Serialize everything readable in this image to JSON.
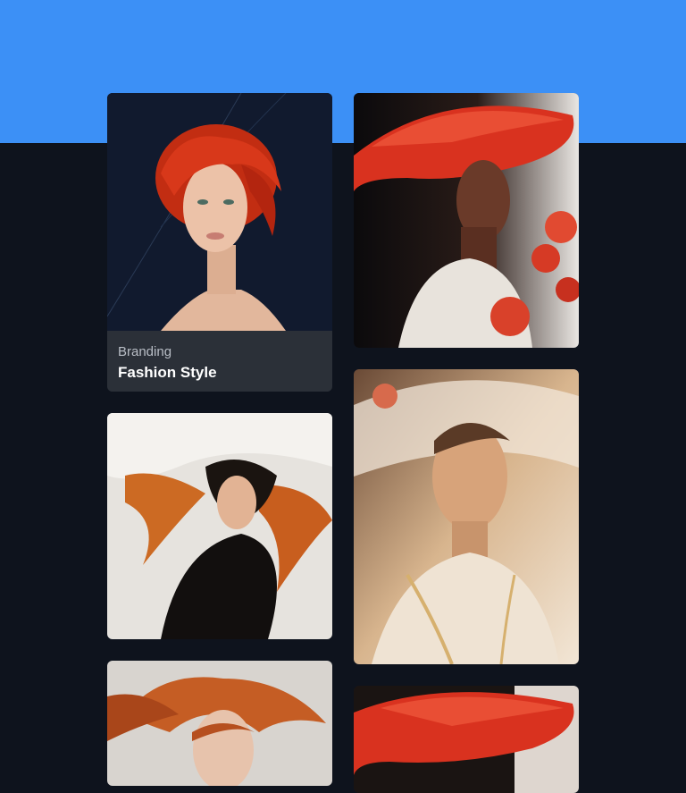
{
  "cards": [
    {
      "image": "portrait-red-curly-hair-navy-background",
      "category": "Branding",
      "title": "Fashion Style"
    },
    {
      "image": "portrait-woman-red-wide-brim-hat-roses"
    },
    {
      "image": "portrait-woman-flowing-hair-white-veil"
    },
    {
      "image": "portrait-woman-sheer-veil-golden-light"
    },
    {
      "image": "portrait-woman-copper-windswept-hair"
    },
    {
      "image": "portrait-woman-red-hat-crop"
    }
  ],
  "colors": {
    "header_band": "#3c90f6",
    "page_background": "#0e131d",
    "caption_background": "#2b3038"
  }
}
